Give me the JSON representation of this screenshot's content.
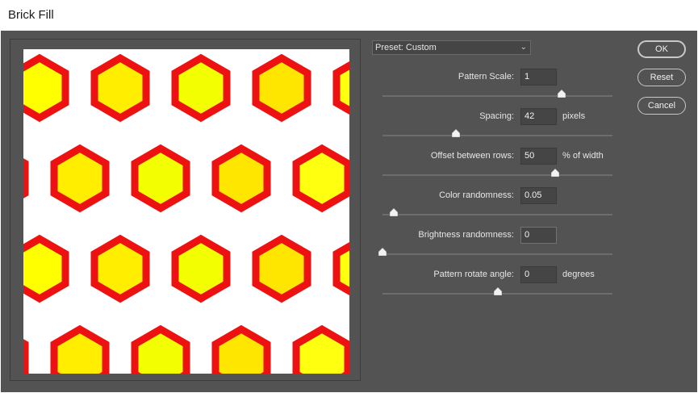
{
  "window": {
    "title": "Brick Fill"
  },
  "preset": {
    "label": "Preset: Custom"
  },
  "buttons": {
    "ok": "OK",
    "reset": "Reset",
    "cancel": "Cancel"
  },
  "params": [
    {
      "label": "Pattern Scale:",
      "value": "1",
      "unit": "",
      "slider_fraction": 0.78
    },
    {
      "label": "Spacing:",
      "value": "42",
      "unit": "pixels",
      "slider_fraction": 0.32
    },
    {
      "label": "Offset between rows:",
      "value": "50",
      "unit": "% of width",
      "slider_fraction": 0.75
    },
    {
      "label": "Color randomness:",
      "value": "0.05",
      "unit": "",
      "slider_fraction": 0.05
    },
    {
      "label": "Brightness randomness:",
      "value": "0",
      "unit": "",
      "slider_fraction": 0.0
    },
    {
      "label": "Pattern rotate angle:",
      "value": "0",
      "unit": "degrees",
      "slider_fraction": 0.5
    }
  ],
  "colors": {
    "hex_fill": "#ffff00",
    "hex_stroke": "#ee1111",
    "accent": "#3f7ad1"
  }
}
